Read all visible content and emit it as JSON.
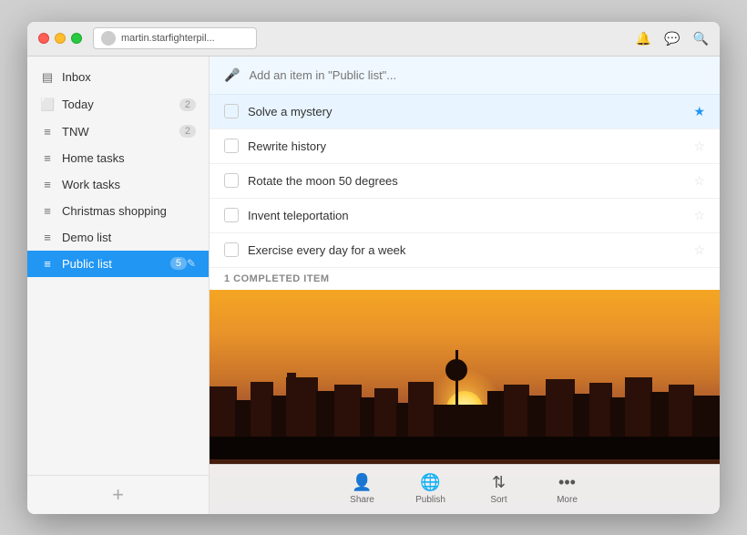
{
  "window": {
    "title": "martin.starfighterpil...",
    "traffic_lights": [
      "close",
      "minimize",
      "maximize"
    ]
  },
  "sidebar": {
    "items": [
      {
        "id": "inbox",
        "icon": "inbox",
        "label": "Inbox",
        "count": null
      },
      {
        "id": "today",
        "icon": "calendar",
        "label": "Today",
        "count": "2"
      },
      {
        "id": "tnw",
        "icon": "list",
        "label": "TNW",
        "count": "2"
      },
      {
        "id": "home-tasks",
        "icon": "list",
        "label": "Home tasks",
        "count": null
      },
      {
        "id": "work-tasks",
        "icon": "list",
        "label": "Work tasks",
        "count": null
      },
      {
        "id": "christmas-shopping",
        "icon": "list",
        "label": "Christmas shopping",
        "count": null
      },
      {
        "id": "demo-list",
        "icon": "list",
        "label": "Demo list",
        "count": null
      },
      {
        "id": "public-list",
        "icon": "list",
        "label": "Public list",
        "count": "5",
        "active": true
      }
    ],
    "add_button": "+"
  },
  "task_area": {
    "add_placeholder": "Add an item in \"Public list\"...",
    "tasks": [
      {
        "id": 1,
        "label": "Solve a mystery",
        "starred": true,
        "selected": true,
        "completed": false
      },
      {
        "id": 2,
        "label": "Rewrite history",
        "starred": false,
        "selected": false,
        "completed": false
      },
      {
        "id": 3,
        "label": "Rotate the moon 50 degrees",
        "starred": false,
        "selected": false,
        "completed": false
      },
      {
        "id": 4,
        "label": "Invent teleportation",
        "starred": false,
        "selected": false,
        "completed": false
      },
      {
        "id": 5,
        "label": "Exercise every day for a week",
        "starred": false,
        "selected": false,
        "completed": false
      }
    ],
    "completed_label": "1 COMPLETED ITEM"
  },
  "toolbar": {
    "buttons": [
      {
        "id": "share",
        "label": "Share",
        "icon": "share"
      },
      {
        "id": "publish",
        "label": "Publish",
        "icon": "publish"
      },
      {
        "id": "sort",
        "label": "Sort",
        "icon": "sort"
      },
      {
        "id": "more",
        "label": "More",
        "icon": "more"
      }
    ]
  }
}
